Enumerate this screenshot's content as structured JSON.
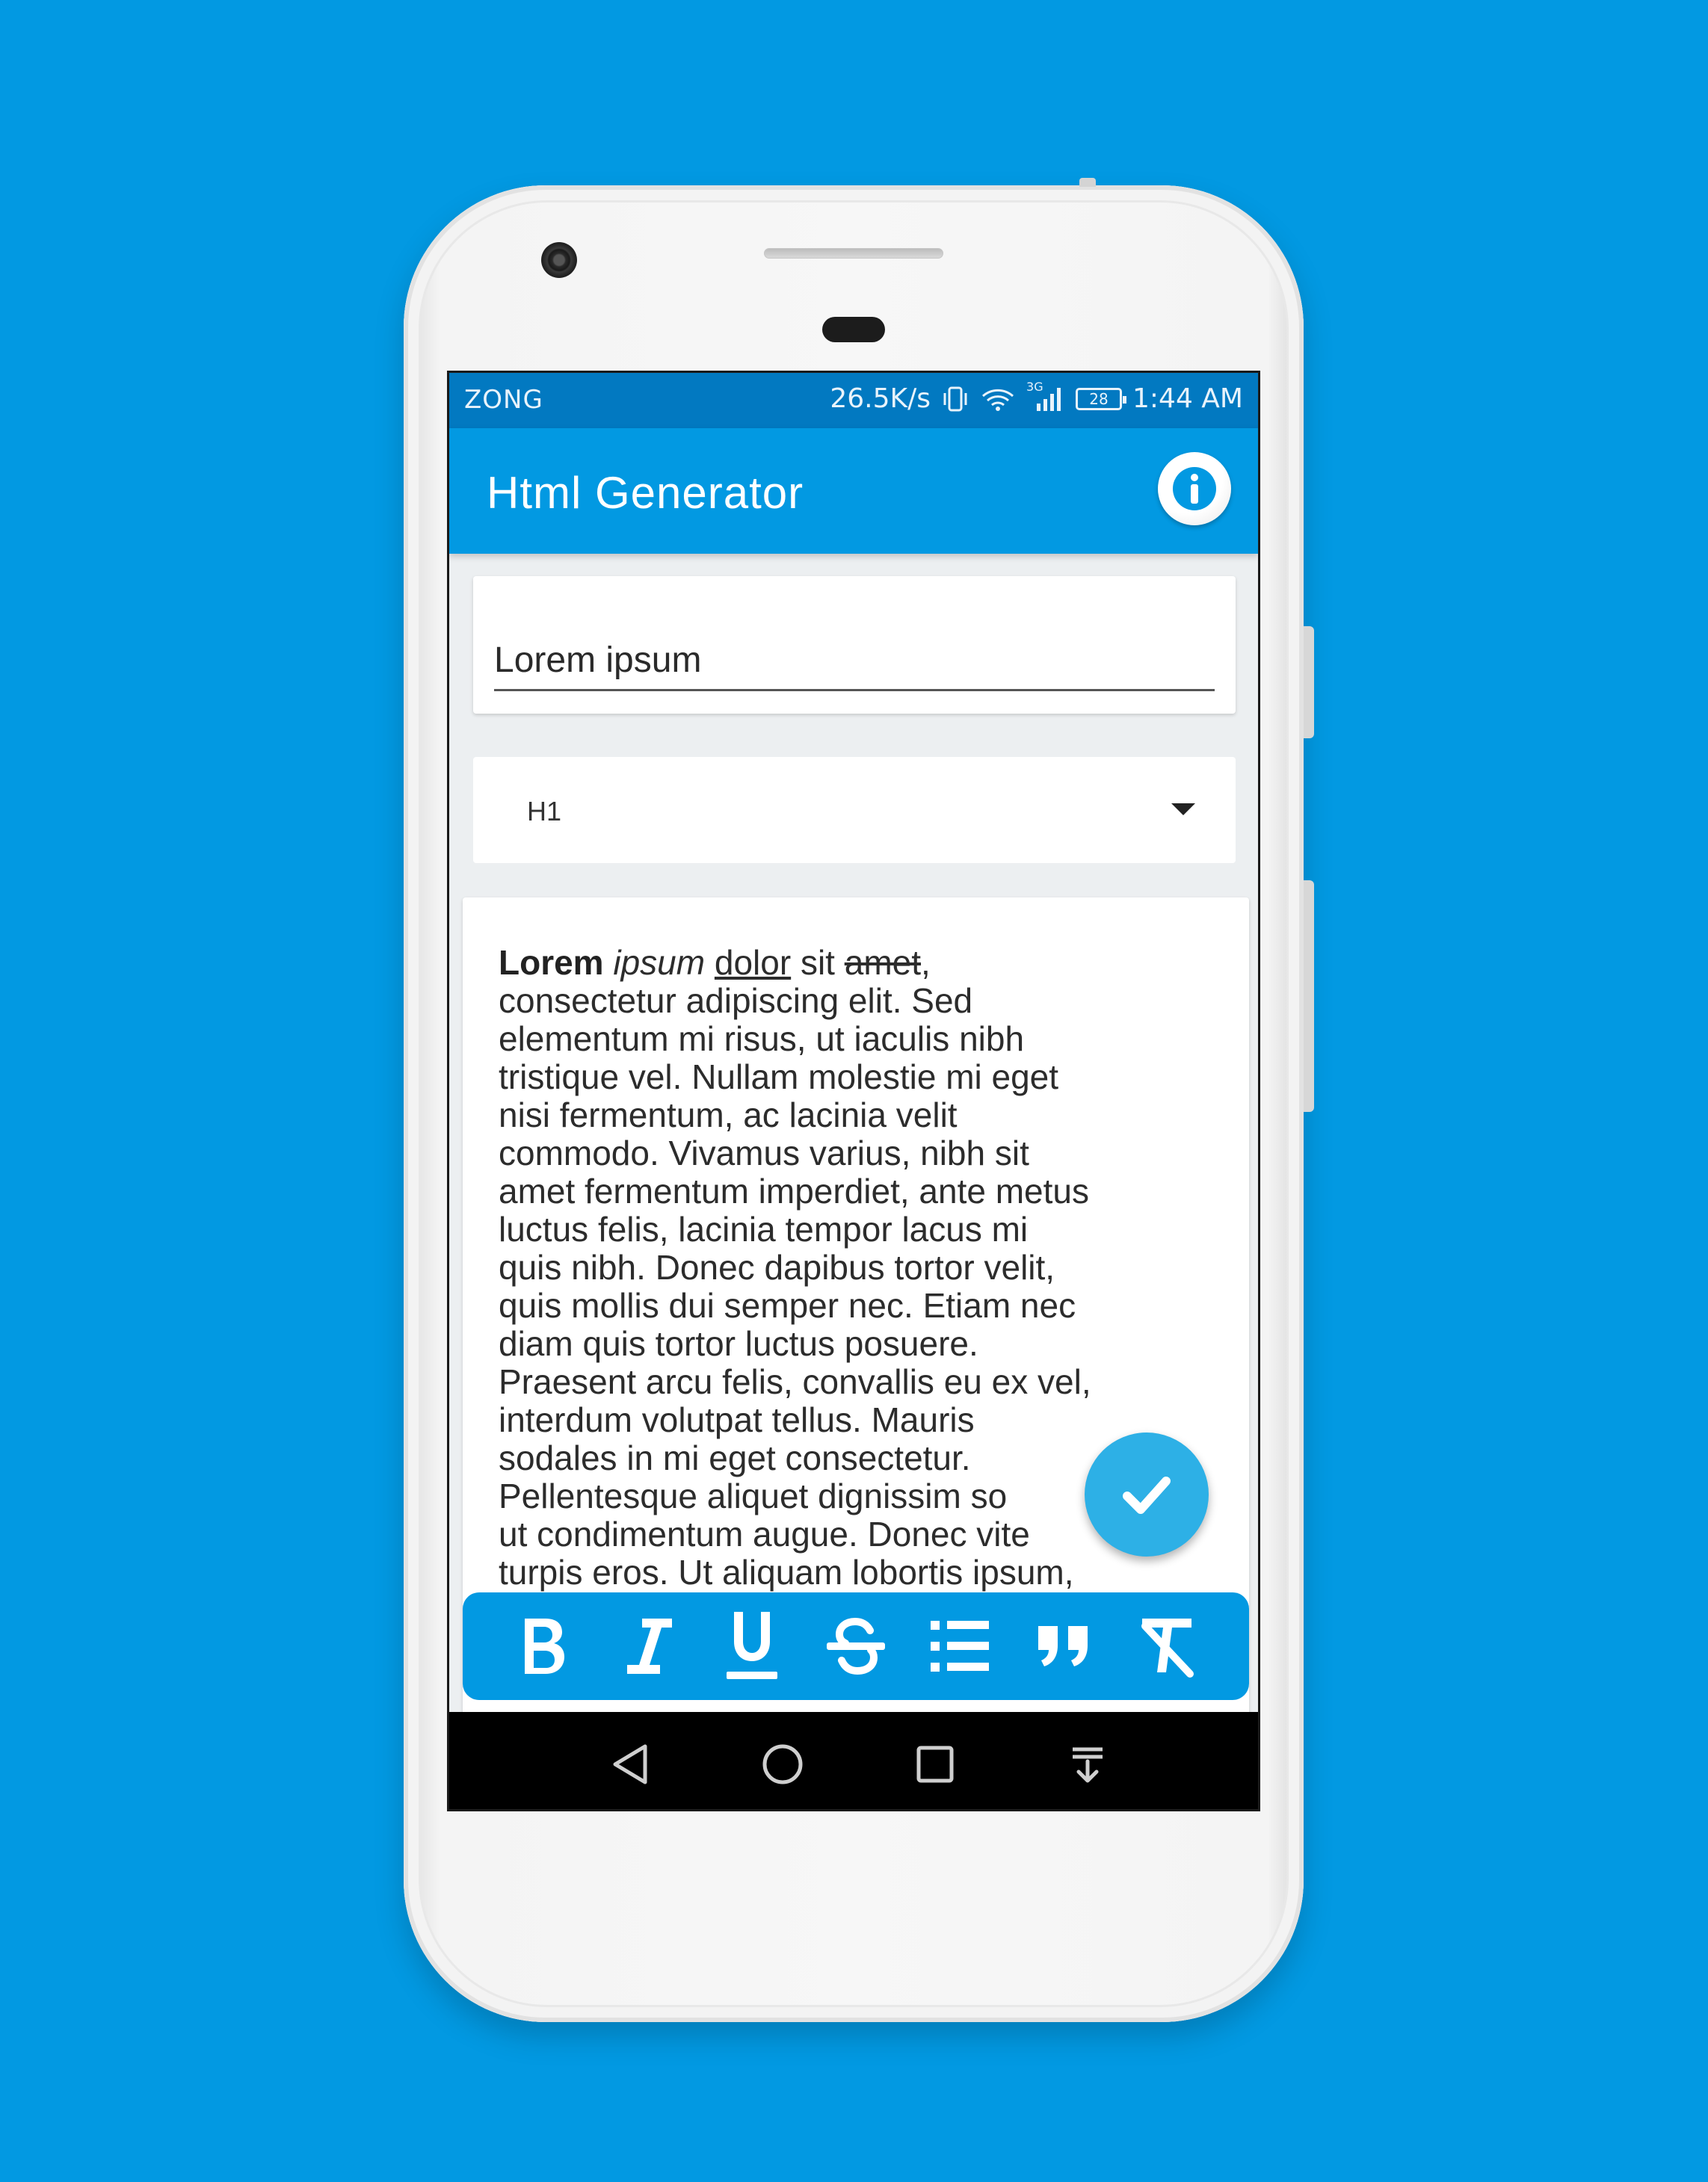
{
  "status_bar": {
    "carrier": "ZONG",
    "speed": "26.5K/s",
    "network_type": "3G",
    "battery": "28",
    "time": "1:44 AM"
  },
  "app_bar": {
    "title": "Html Generator",
    "info_icon": "info-icon"
  },
  "title_field": {
    "value": "Lorem ipsum"
  },
  "heading_select": {
    "selected": "H1"
  },
  "editor": {
    "w_bold": "Lorem",
    "w_italic": "ipsum",
    "w_underline": "dolor",
    "w_plain": "sit",
    "w_strike": "amet",
    "rest": ",\nconsectetur adipiscing elit. Sed\nelementum mi risus, ut iaculis nibh\ntristique vel. Nullam molestie mi eget\nnisi fermentum, ac lacinia velit\ncommodo. Vivamus varius, nibh sit\namet fermentum imperdiet, ante metus\nluctus felis, lacinia tempor lacus mi\nquis nibh. Donec dapibus tortor velit,\nquis mollis dui semper nec. Etiam nec\ndiam quis tortor luctus posuere.\nPraesent arcu felis, convallis eu ex vel,\ninterdum volutpat tellus. Mauris\nsodales in mi eget consectetur.\nPellentesque aliquet dignissim so\nut condimentum augue. Donec vite\nturpis eros. Ut aliquam lobortis ipsum,"
  },
  "fab": {
    "icon": "check-icon"
  },
  "toolbar": {
    "buttons": [
      "bold-icon",
      "italic-icon",
      "underline-icon",
      "strikethrough-icon",
      "list-icon",
      "quote-icon",
      "clear-format-icon"
    ]
  },
  "nav_bar": {
    "buttons": [
      "back-icon",
      "home-icon",
      "recents-icon",
      "notification-pull-icon"
    ]
  },
  "colors": {
    "background": "#0299e2",
    "status_bar": "#0279c1",
    "app_bar": "#0299e2",
    "fab": "#2db0e6"
  }
}
